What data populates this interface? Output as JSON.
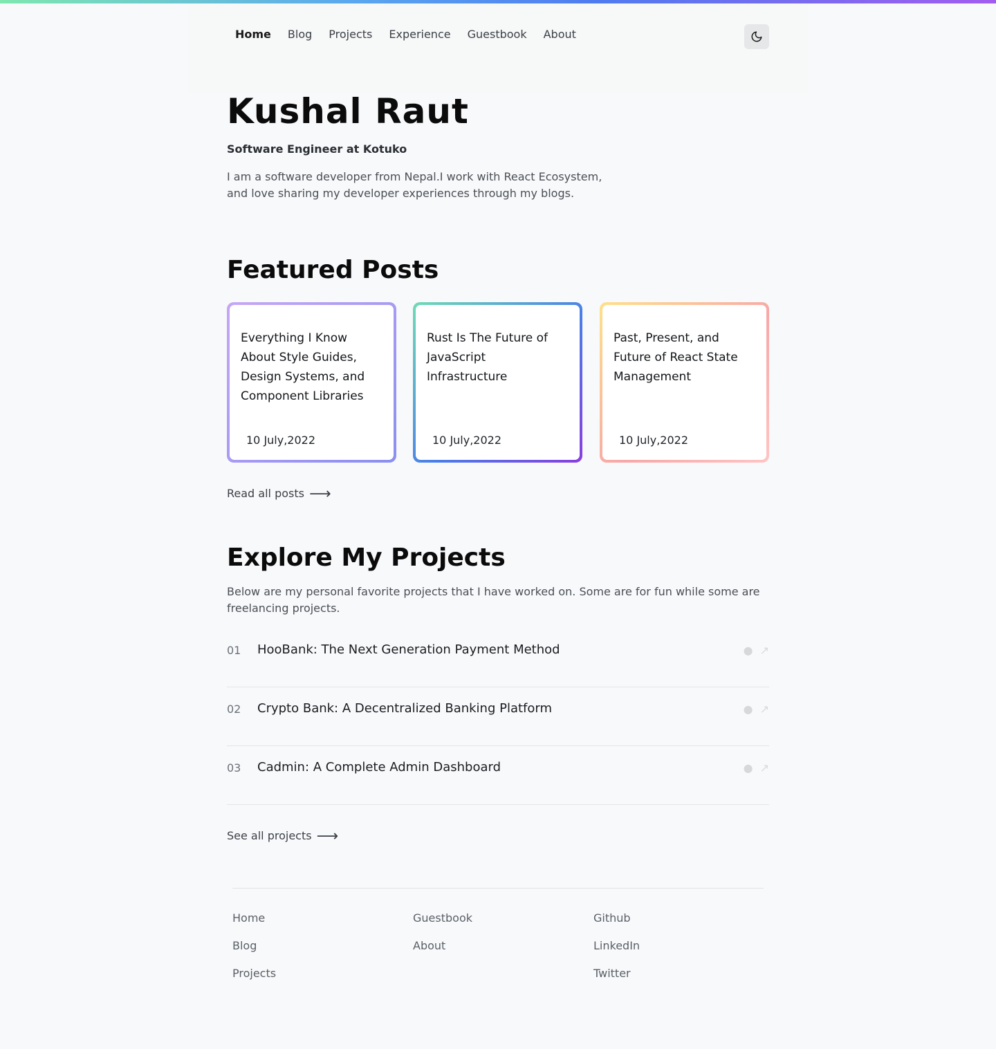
{
  "colors": {
    "accent_gradient": [
      "#7ee8b0",
      "#5aa8ef",
      "#4f7bf0",
      "#a25cf0"
    ],
    "card1_border": [
      "#c6a7f5",
      "#8a8ff0"
    ],
    "card2_border": [
      "#6fdbb5",
      "#4a7ee8",
      "#8a3ee0"
    ],
    "card3_border": [
      "#ffe08a",
      "#f7a8a8",
      "#ffc4c4"
    ]
  },
  "nav": {
    "items": [
      {
        "label": "Home",
        "active": true
      },
      {
        "label": "Blog"
      },
      {
        "label": "Projects"
      },
      {
        "label": "Experience"
      },
      {
        "label": "Guestbook"
      },
      {
        "label": "About"
      }
    ],
    "theme_icon": "moon-icon"
  },
  "hero": {
    "name": "Kushal Raut",
    "role": "Software Engineer at Kotuko",
    "bio": "I am a software developer from Nepal.I work with React Ecosystem, and love sharing my developer experiences through my blogs."
  },
  "featured": {
    "heading": "Featured Posts",
    "posts": [
      {
        "title": "Everything I Know About Style Guides, Design Systems, and Component Libraries",
        "date": "10 July,2022"
      },
      {
        "title": "Rust Is The Future of JavaScript Infrastructure",
        "date": "10 July,2022"
      },
      {
        "title": "Past, Present, and Future of React State Management",
        "date": "10 July,2022"
      }
    ],
    "read_all": "Read all posts",
    "arrow_icon": "arrow-right-icon"
  },
  "projects": {
    "heading": "Explore My Projects",
    "intro": "Below are my personal favorite projects that I have worked on. Some are for fun while some are freelancing projects.",
    "items": [
      {
        "num": "01",
        "title": "HooBank: The Next Generation Payment Method"
      },
      {
        "num": "02",
        "title": "Crypto Bank: A Decentralized Banking Platform"
      },
      {
        "num": "03",
        "title": "Cadmin: A Complete Admin Dashboard"
      }
    ],
    "see_all": "See all projects"
  },
  "footer": {
    "col1": [
      "Home",
      "Blog",
      "Projects"
    ],
    "col2": [
      "Guestbook",
      "About"
    ],
    "col3": [
      "Github",
      "LinkedIn",
      "Twitter"
    ]
  }
}
